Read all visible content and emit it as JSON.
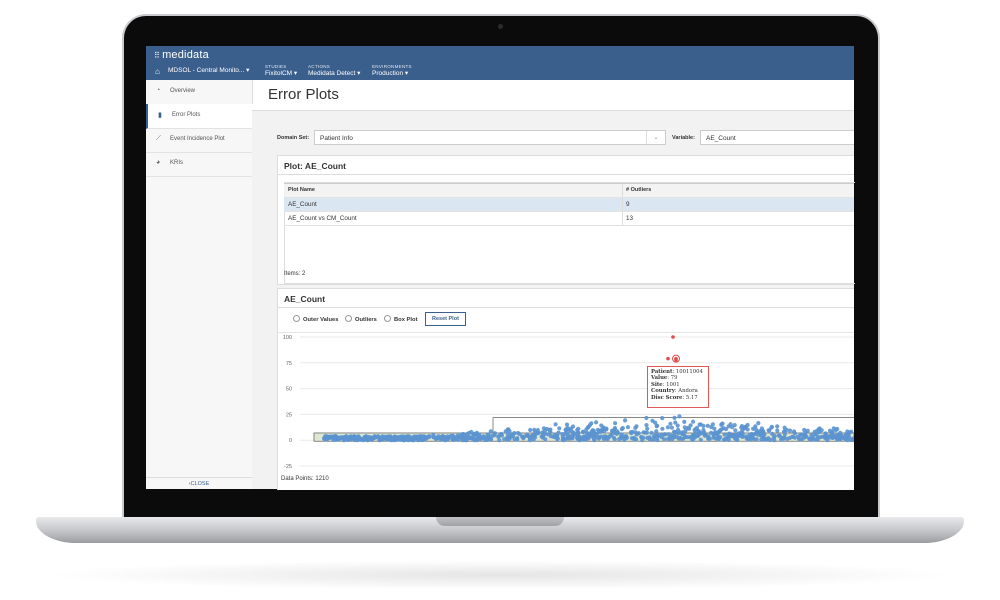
{
  "app": {
    "logo_text": "medidata",
    "home_icon": "home-icon",
    "nav": [
      {
        "label": "",
        "value": "MDSOL - Central Monito... ▾"
      },
      {
        "label": "STUDIES",
        "value": "FixitolCM ▾"
      },
      {
        "label": "ACTIONS",
        "value": "Medidata Detect ▾"
      },
      {
        "label": "ENVIRONMENTS",
        "value": "Production ▾"
      }
    ]
  },
  "sidebar": {
    "items": [
      {
        "label": "Overview",
        "icon": "dashboard-icon"
      },
      {
        "label": "Error Plots",
        "icon": "bar-chart-icon",
        "active": true
      },
      {
        "label": "Event Incidence Plot",
        "icon": "line-chart-icon"
      },
      {
        "label": "KRIs",
        "icon": "pie-chart-icon"
      }
    ],
    "close_label": "CLOSE"
  },
  "page": {
    "title": "Error Plots",
    "domain_set_label": "Domain Set:",
    "domain_set_value": "Patient Info",
    "variable_label": "Variable:",
    "variable_value": "AE_Count"
  },
  "plot_panel": {
    "title": "Plot: AE_Count",
    "columns": [
      "Plot Name",
      "# Outliers"
    ],
    "rows": [
      {
        "name": "AE_Count",
        "outliers": "9"
      },
      {
        "name": "AE_Count vs CM_Count",
        "outliers": "13"
      }
    ],
    "items_label": "Items",
    "items_count": "2"
  },
  "chart_panel": {
    "title": "AE_Count",
    "options": [
      "Outer Values",
      "Outliers",
      "Box Plot"
    ],
    "reset_label": "Reset Plot",
    "data_points_label": "Data Points",
    "data_points_value": "1210"
  },
  "tooltip": {
    "patient_label": "Patient",
    "patient": "10011004",
    "value_label": "Value",
    "value": "79",
    "site_label": "Site",
    "site": "1001",
    "country_label": "Country",
    "country": "Andora",
    "disc_label": "Disc Score",
    "disc": "5.17"
  },
  "colors": {
    "header": "#3b5f8c",
    "points": "#5b93cf",
    "outlier": "#e04b4b"
  },
  "chart_data": {
    "type": "scatter",
    "title": "AE_Count",
    "ylabel": "",
    "ylim": [
      -25,
      100
    ],
    "y_ticks": [
      "100",
      "75",
      "50",
      "25",
      "0",
      "-25"
    ],
    "y_tick_values": [
      100,
      75,
      50,
      25,
      0,
      -25
    ],
    "whisker_upper": 22,
    "box_range": [
      -1,
      7
    ],
    "points_y_range": [
      0,
      27
    ],
    "outliers": [
      {
        "value": 100
      },
      {
        "value": 79
      },
      {
        "value": 78
      },
      {
        "value": 79
      }
    ]
  }
}
